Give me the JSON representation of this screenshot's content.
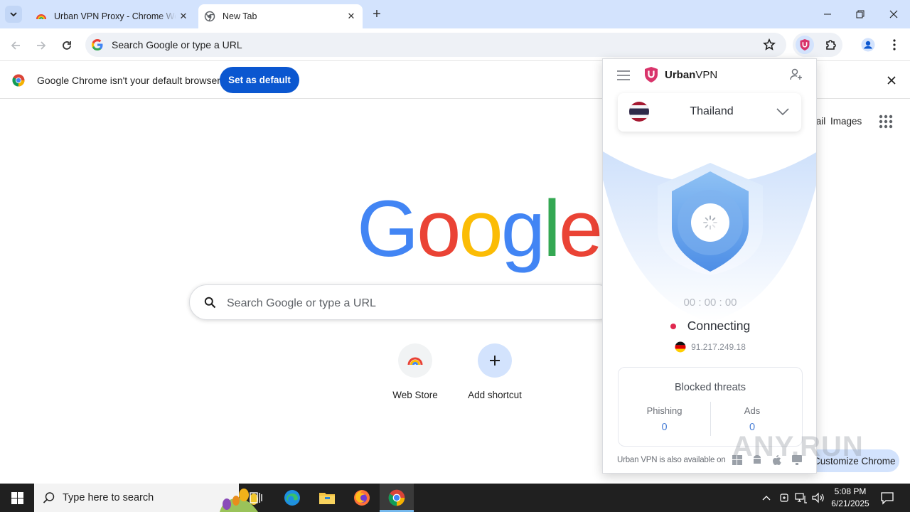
{
  "browser": {
    "tabs": [
      {
        "title": "Urban VPN Proxy - Chrome Web Store"
      },
      {
        "title": "New Tab"
      }
    ],
    "omnibox_placeholder": "Search Google or type a URL",
    "infobar": {
      "message": "Google Chrome isn't your default browser",
      "button": "Set as default"
    }
  },
  "newtab": {
    "top_links": {
      "gmail": "Gmail",
      "images": "Images"
    },
    "search_placeholder": "Search Google or type a URL",
    "shortcuts": [
      {
        "label": "Web Store"
      },
      {
        "label": "Add shortcut"
      }
    ],
    "customize": "Customize Chrome"
  },
  "vpn": {
    "brand_bold": "Urban",
    "brand_rest": "VPN",
    "country": "Thailand",
    "timer": "00 : 00 : 00",
    "status": "Connecting",
    "ip": "91.217.249.18",
    "threats": {
      "title": "Blocked threats",
      "phishing_label": "Phishing",
      "phishing_value": "0",
      "ads_label": "Ads",
      "ads_value": "0"
    },
    "footer": "Urban VPN is also available on"
  },
  "watermark": "ANY.RUN",
  "taskbar": {
    "search_placeholder": "Type here to search",
    "time": "5:08 PM",
    "date": "6/21/2025"
  },
  "colors": {
    "tabstrip": "#d3e3fd",
    "accent": "#0b57d0",
    "vpn_shield": "#6fa8ee",
    "status_dot": "#e0284f",
    "taskbar": "#202020"
  }
}
